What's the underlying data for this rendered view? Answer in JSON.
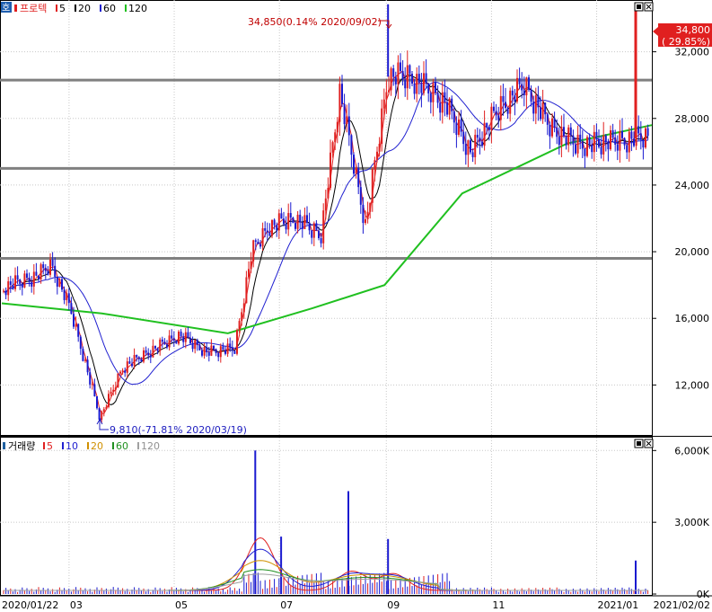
{
  "price_panel": {
    "icon_label": "호",
    "legend": {
      "title": "프로텍",
      "ma": [
        {
          "label": "5",
          "color": "#e02020"
        },
        {
          "label": "20",
          "color": "#000000"
        },
        {
          "label": "60",
          "color": "#2020d0"
        },
        {
          "label": "120",
          "color": "#20c020"
        }
      ]
    },
    "current_price": "34,800",
    "current_change": "( 29.85%)",
    "high_annotation": "34,850(0.14% 2020/09/02)",
    "low_annotation": "9,810(-71.81% 2020/03/19)",
    "y_ticks": [
      "32,000",
      "28,000",
      "24,000",
      "20,000",
      "16,000",
      "12,000"
    ]
  },
  "volume_panel": {
    "legend": {
      "title": "거래량",
      "ma": [
        {
          "label": "5",
          "color": "#e02020"
        },
        {
          "label": "10",
          "color": "#2020d0"
        },
        {
          "label": "20",
          "color": "#d09000"
        },
        {
          "label": "60",
          "color": "#209020"
        },
        {
          "label": "120",
          "color": "#a0a0a0"
        }
      ]
    },
    "y_ticks": [
      "6,000K",
      "3,000K",
      "0K"
    ]
  },
  "x_axis": {
    "labels": [
      "2020/01/22",
      "03",
      "05",
      "07",
      "09",
      "11",
      "2021/01",
      "2021/02/02"
    ]
  },
  "chart_data": [
    {
      "type": "candlestick",
      "title": "프로텍",
      "ylim": [
        9000,
        35000
      ],
      "horizontal_lines": [
        30300,
        25000,
        19600
      ],
      "x_labels": [
        "2020/01/22",
        "03",
        "05",
        "07",
        "09",
        "11",
        "2021/01"
      ],
      "series_close": [
        {
          "date": "2020/01/22",
          "close": 17800
        },
        {
          "date": "2020/02/10",
          "close": 18500
        },
        {
          "date": "2020/02/20",
          "close": 19200
        },
        {
          "date": "2020/03/02",
          "close": 16500
        },
        {
          "date": "2020/03/10",
          "close": 13500
        },
        {
          "date": "2020/03/19",
          "close": 10000,
          "low": 9810
        },
        {
          "date": "2020/04/01",
          "close": 13000
        },
        {
          "date": "2020/04/20",
          "close": 14200
        },
        {
          "date": "2020/05/04",
          "close": 15000
        },
        {
          "date": "2020/05/20",
          "close": 14000
        },
        {
          "date": "2020/06/05",
          "close": 14100
        },
        {
          "date": "2020/06/15",
          "close": 20000
        },
        {
          "date": "2020/06/25",
          "close": 21500
        },
        {
          "date": "2020/07/10",
          "close": 22000
        },
        {
          "date": "2020/07/25",
          "close": 21000
        },
        {
          "date": "2020/08/05",
          "close": 29500
        },
        {
          "date": "2020/08/20",
          "close": 21500
        },
        {
          "date": "2020/09/02",
          "close": 30500,
          "high": 34850
        },
        {
          "date": "2020/09/15",
          "close": 30500
        },
        {
          "date": "2020/10/05",
          "close": 29000
        },
        {
          "date": "2020/10/20",
          "close": 26000
        },
        {
          "date": "2020/11/05",
          "close": 28500
        },
        {
          "date": "2020/11/20",
          "close": 30000
        },
        {
          "date": "2020/12/05",
          "close": 27500
        },
        {
          "date": "2020/12/20",
          "close": 26500
        },
        {
          "date": "2021/01/10",
          "close": 26500
        },
        {
          "date": "2021/01/25",
          "close": 26800
        },
        {
          "date": "2021/02/01",
          "close": 26800
        },
        {
          "date": "2021/02/02",
          "close": 34800,
          "change_pct": 29.85
        }
      ],
      "ma_120": [
        {
          "date": "2020/01/22",
          "value": 16900
        },
        {
          "date": "2020/03/20",
          "value": 16300
        },
        {
          "date": "2020/06/01",
          "value": 15100
        },
        {
          "date": "2020/07/20",
          "value": 16600
        },
        {
          "date": "2020/08/31",
          "value": 18000
        },
        {
          "date": "2020/10/15",
          "value": 23500
        },
        {
          "date": "2020/12/15",
          "value": 26500
        },
        {
          "date": "2021/02/02",
          "value": 27600
        }
      ]
    },
    {
      "type": "bar",
      "title": "거래량",
      "ylim": [
        0,
        6500
      ],
      "unit": "K",
      "peaks": [
        {
          "date": "2020/06/17",
          "value": 6000
        },
        {
          "date": "2020/07/02",
          "value": 2400
        },
        {
          "date": "2020/08/10",
          "value": 4300
        },
        {
          "date": "2020/09/02",
          "value": 2300
        },
        {
          "date": "2021/02/02",
          "value": 1400
        }
      ]
    }
  ]
}
